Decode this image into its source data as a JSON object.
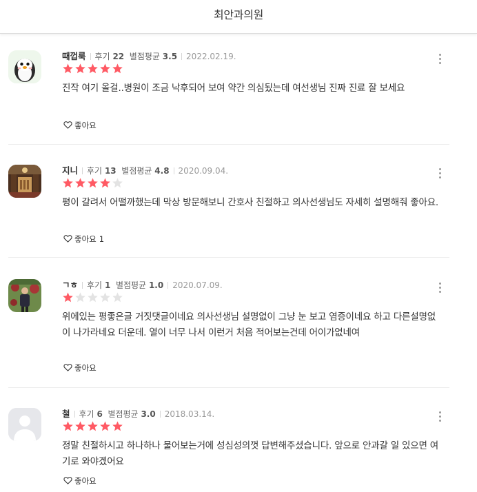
{
  "header": {
    "title": "최안과의원"
  },
  "actions": {
    "like_label": "좋아요"
  },
  "colors": {
    "star_filled": "#ff5a64",
    "star_empty": "#e3e3e3"
  },
  "reviews": [
    {
      "nickname": "때껍룩",
      "review_label": "후기",
      "review_count": "22",
      "avg_label": "별점평균",
      "avg_rating": "3.5",
      "date": "2022.02.19.",
      "rating": 5,
      "text": "진작 여기 올걸..병원이 조금 낙후되어 보여 약간 의심됬는데 여선생님 진짜 진료 잘 보세요",
      "like_count": "",
      "avatar": "penguin"
    },
    {
      "nickname": "지니",
      "review_label": "후기",
      "review_count": "13",
      "avg_label": "별점평균",
      "avg_rating": "4.8",
      "date": "2020.09.04.",
      "rating": 4,
      "text": "평이 갈려서 어떨까했는데 막상 방문해보니 간호사 친절하고 의사선생님도 자세히 설명해줘 좋아요.",
      "like_count": "1",
      "avatar": "library"
    },
    {
      "nickname": "ㄱㅎ",
      "review_label": "후기",
      "review_count": "1",
      "avg_label": "별점평균",
      "avg_rating": "1.0",
      "date": "2020.07.09.",
      "rating": 1,
      "text": "위에있는 평좋은글 거짓댓글이네요 의사선생님 설명없이 그냥 눈 보고 염증이네요 하고 다른설명없이 나가라네요 더운데. 열이 너무 나서 이런거 처음 적어보는건데 어이가없네여",
      "like_count": "",
      "avatar": "person-photo"
    },
    {
      "nickname": "철",
      "review_label": "후기",
      "review_count": "6",
      "avg_label": "별점평균",
      "avg_rating": "3.0",
      "date": "2018.03.14.",
      "rating": 5,
      "text": "정말 친절하시고 하나하나 물어보는거에 성심성의껏 답변해주셨습니다. 앞으로 안과갈 일 있으면 여기로 와야겠어요",
      "like_count": "",
      "avatar": "default-user"
    }
  ]
}
